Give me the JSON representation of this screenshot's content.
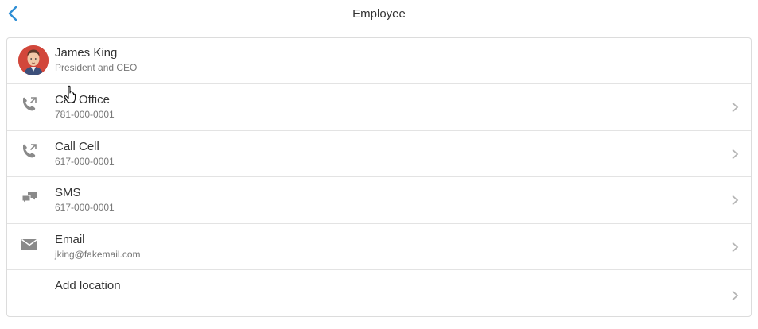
{
  "header": {
    "title": "Employee",
    "back_icon": "chevron-left-icon",
    "accent_color": "#2f8fd5"
  },
  "profile": {
    "name": "James King",
    "role": "President and CEO",
    "avatar_icon": "avatar-portrait"
  },
  "actions": [
    {
      "label": "Call Office",
      "value": "781-000-0001",
      "icon": "phone-call-icon"
    },
    {
      "label": "Call Cell",
      "value": "617-000-0001",
      "icon": "phone-call-icon"
    },
    {
      "label": "SMS",
      "value": "617-000-0001",
      "icon": "chat-bubbles-icon"
    },
    {
      "label": "Email",
      "value": "jking@fakemail.com",
      "icon": "envelope-icon"
    },
    {
      "label": "Add location",
      "value": "",
      "icon": ""
    }
  ],
  "colors": {
    "icon_gray": "#8a8a8a",
    "chevron_gray": "#b5b5b5",
    "divider": "#e3e3e3"
  }
}
